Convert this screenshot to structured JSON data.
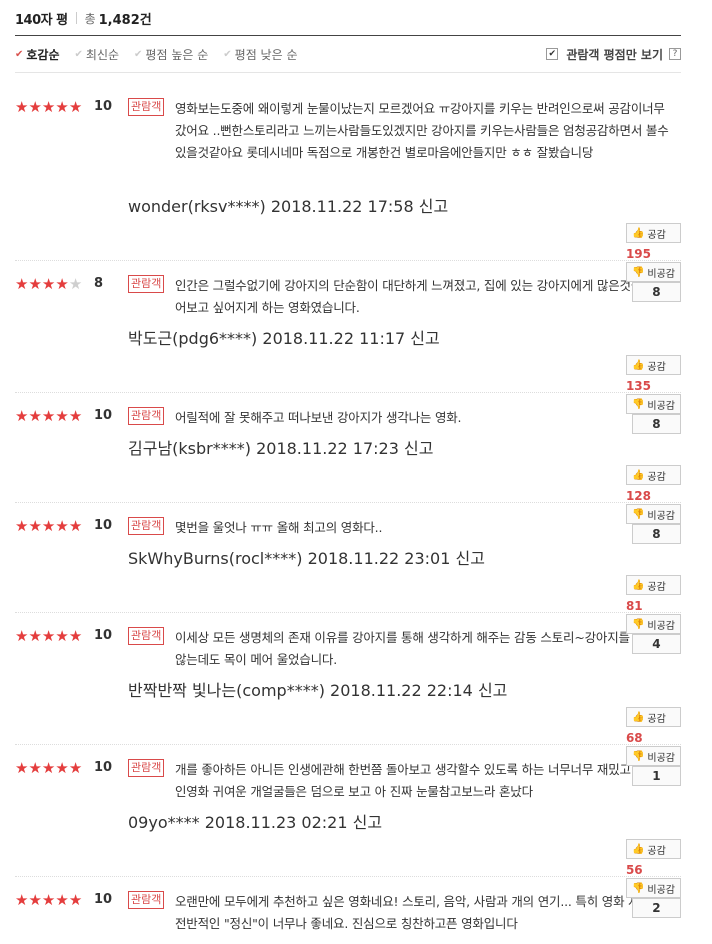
{
  "header": {
    "title": "140자 평",
    "total_label": "총",
    "total_count": "1,482건"
  },
  "sort": {
    "items": [
      {
        "label": "호감순",
        "active": true
      },
      {
        "label": "최신순",
        "active": false
      },
      {
        "label": "평점 높은 순",
        "active": false
      },
      {
        "label": "평점 낮은 순",
        "active": false
      }
    ],
    "viewer_only_label": "관람객 평점만 보기",
    "viewer_only_checked": true,
    "help_glyph": "?"
  },
  "badge_label": "관람객",
  "like_label": "공감",
  "dislike_label": "비공감",
  "report_label": "신고",
  "reviews": [
    {
      "stars": 5,
      "score": "10",
      "text": "영화보는도중에 왜이렇게 눈물이났는지 모르겠어요 ㅠ강아지를 키우는 반려인으로써 공감이너무갔어요 ..뻔한스토리라고 느끼는사람들도있겠지만 강아지를 키우는사람들은 엄청공감하면서 볼수있을것같아요 롯데시네마 독점으로 개봉한건 별로마음에안들지만 ㅎㅎ 잘봤습니당",
      "user": "wonder(rksv****)",
      "date": "2018.11.22 17:58",
      "likes": "195",
      "dislikes": "8"
    },
    {
      "stars": 4,
      "score": "8",
      "text": "인간은 그럴수없기에 강아지의 단순함이 대단하게 느껴졌고, 집에 있는 강아지에게 많은것들을 물어보고 싶어지게 하는 영화였습니다.",
      "user": "박도근(pdg6****)",
      "date": "2018.11.22 11:17",
      "likes": "135",
      "dislikes": "8"
    },
    {
      "stars": 5,
      "score": "10",
      "text": "어릴적에 잘 못해주고 떠나보낸 강아지가 생각나는 영화.",
      "user": "김구남(ksbr****)",
      "date": "2018.11.22 17:23",
      "likes": "128",
      "dislikes": "8"
    },
    {
      "stars": 5,
      "score": "10",
      "text": "몇번을 울엇나 ㅠㅠ 올해 최고의 영화다..",
      "user": "SkWhyBurns(rocl****)",
      "date": "2018.11.22 23:01",
      "likes": "81",
      "dislikes": "4"
    },
    {
      "stars": 5,
      "score": "10",
      "text": "이세상 모든 생명체의 존재 이유를 강아지를 통해 생각하게 해주는 감동 스토리~강아지를 키우지 않는데도 목이 메어 울었습니다.",
      "user": "반짝반짝 빛나는(comp****)",
      "date": "2018.11.22 22:14",
      "likes": "68",
      "dislikes": "1"
    },
    {
      "stars": 5,
      "score": "10",
      "text": "개를 좋아하든 아니든 인생에관해 한번쯤 돌아보고 생각할수 있도록 하는 너무너무 재밌고 감동적인영화 귀여운 개얼굴들은 덤으로 보고 아 진짜 눈물참고보느라 혼났다",
      "user": "09yo****",
      "date": "2018.11.23 02:21",
      "likes": "56",
      "dislikes": "2"
    },
    {
      "stars": 5,
      "score": "10",
      "text": "오랜만에 모두에게 추천하고 싶은 영화네요! 스토리, 음악, 사람과 개의 연기... 특히 영화 자체의 전반적인 \"정신\"이 너무나 좋네요. 진심으로 칭찬하고픈 영화입니다",
      "user": "",
      "date": "",
      "likes": "",
      "dislikes": ""
    }
  ],
  "colors": {
    "star_on": "#e43d3d",
    "star_off": "#cfcfcf",
    "badge": "#d94a4a",
    "like_count": "#d94a4a"
  },
  "icons": {
    "sort_check": "check-icon",
    "like": "thumbs-up-icon",
    "dislike": "thumbs-down-icon",
    "checkbox": "checkbox-icon",
    "help": "help-icon",
    "star": "star-icon"
  }
}
